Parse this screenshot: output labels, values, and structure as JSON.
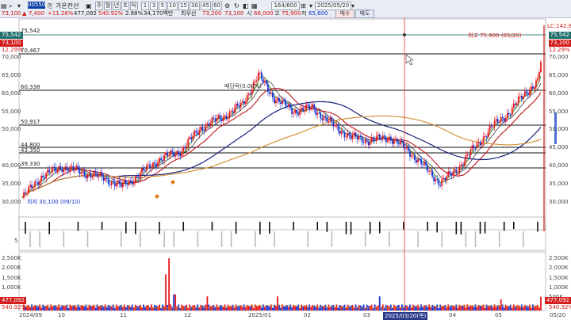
{
  "toolbar": {
    "code": "005500",
    "name": "가온전선",
    "period_buttons": [
      "주",
      "월",
      "년",
      "초",
      "틱"
    ],
    "interval_buttons": [
      "1",
      "3",
      "5",
      "10",
      "15",
      "30",
      "45",
      "60"
    ],
    "count": "164/600",
    "date": "2025/05/20",
    "buy_label": "매수",
    "sell_label": "매도",
    "price": "73,100",
    "change": "7,400",
    "change_pct": "+11.26%",
    "volume": "477,092",
    "vol_ratio": "540.92%",
    "turnover_rate": "2.88%",
    "amount": "34,170백만",
    "open_label": "최우선",
    "open_ask": "73,200",
    "open_bid": "73,100",
    "start_label": "시",
    "start": "66,000",
    "high_label": "고",
    "high": "75,900",
    "low_label": "저",
    "low": "65,600"
  },
  "levels": [
    "75,542",
    "70,467",
    "60,338",
    "50,917",
    "44,800",
    "43,350",
    "39,330"
  ],
  "annotations": {
    "dividend": "배당락(0.00%)",
    "high_note": "최고 75,900 (05/20)",
    "low_note": "최저 30,100 (09/10)"
  },
  "right_tags": {
    "lc": "LC:142.86",
    "current": "73,100",
    "pct": "12.29%",
    "cross": "75,542",
    "vol_current": "477,092",
    "vol_pct": "540.92%"
  },
  "left_tags": {
    "cross": "75,542",
    "current": "73,100",
    "pct": "12.29%",
    "vol_a": "477,092",
    "vol_b": "540.92%"
  },
  "price_axis": [
    "75,000",
    "70,000",
    "65,000",
    "60,000",
    "55,000",
    "50,000",
    "45,000",
    "40,000",
    "35,000",
    "30,000"
  ],
  "vol_axis": [
    "2,500K",
    "2,000K",
    "1,500K",
    "1,000K",
    "500K"
  ],
  "mid_axis": [
    "5"
  ],
  "date_axis": [
    "2024/09",
    "10",
    "11",
    "12",
    "2025/01",
    "02",
    "03",
    "04",
    "05",
    "05/20"
  ],
  "crosshair_date": "2025/03/20(목)",
  "colors": {
    "up": "#e8171b",
    "down": "#1a35d6",
    "ma5": "#1ca51c",
    "ma20": "#c0141b",
    "ma60": "#17207a",
    "ma120": "#d08a2b",
    "ma10": "#222222"
  },
  "chart_data": {
    "type": "candlestick",
    "x": [
      "2024/09",
      "2024/10",
      "2024/11",
      "2024/12",
      "2025/01",
      "2025/02",
      "2025/03",
      "2025/04",
      "2025/05"
    ],
    "close": [
      36000,
      40000,
      38000,
      46000,
      60000,
      56000,
      49000,
      37000,
      73100
    ],
    "ylim": [
      28000,
      78000
    ],
    "grid": false
  }
}
